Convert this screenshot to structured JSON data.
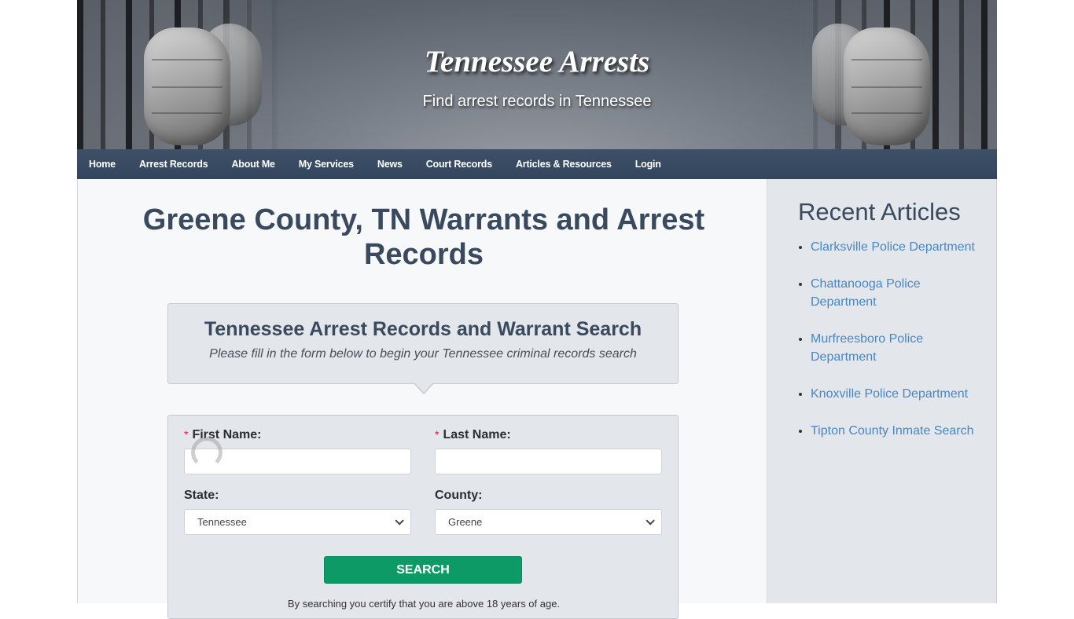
{
  "header": {
    "site_title": "Tennessee Arrests",
    "tagline": "Find arrest records in Tennessee"
  },
  "nav": {
    "items": [
      {
        "label": "Home"
      },
      {
        "label": "Arrest Records"
      },
      {
        "label": "About Me"
      },
      {
        "label": "My Services"
      },
      {
        "label": "News"
      },
      {
        "label": "Court Records"
      },
      {
        "label": "Articles & Resources"
      },
      {
        "label": "Login"
      }
    ]
  },
  "main": {
    "page_title": "Greene County, TN Warrants and Arrest Records",
    "intro": {
      "title": "Tennessee Arrest Records and Warrant Search",
      "subtitle": "Please fill in the form below to begin your Tennessee criminal records search"
    },
    "form": {
      "required_marker": "*",
      "first_name": {
        "label": "First Name:",
        "value": ""
      },
      "last_name": {
        "label": "Last Name:",
        "value": ""
      },
      "state": {
        "label": "State:",
        "selected": "Tennessee"
      },
      "county": {
        "label": "County:",
        "selected": "Greene"
      },
      "search_label": "SEARCH",
      "disclaimer": "By searching you certify that you are above 18 years of age."
    }
  },
  "sidebar": {
    "title": "Recent Articles",
    "articles": [
      {
        "label": "Clarksville Police Department"
      },
      {
        "label": "Chattanooga Police Department"
      },
      {
        "label": "Murfreesboro Police Department"
      },
      {
        "label": "Knoxville Police Department"
      },
      {
        "label": "Tipton County Inmate Search"
      }
    ]
  },
  "colors": {
    "nav_bg": "#3a4c63",
    "heading": "#3a4a5e",
    "link": "#4a86c0",
    "search_button": "#0e9a66",
    "required": "#e0262c"
  }
}
